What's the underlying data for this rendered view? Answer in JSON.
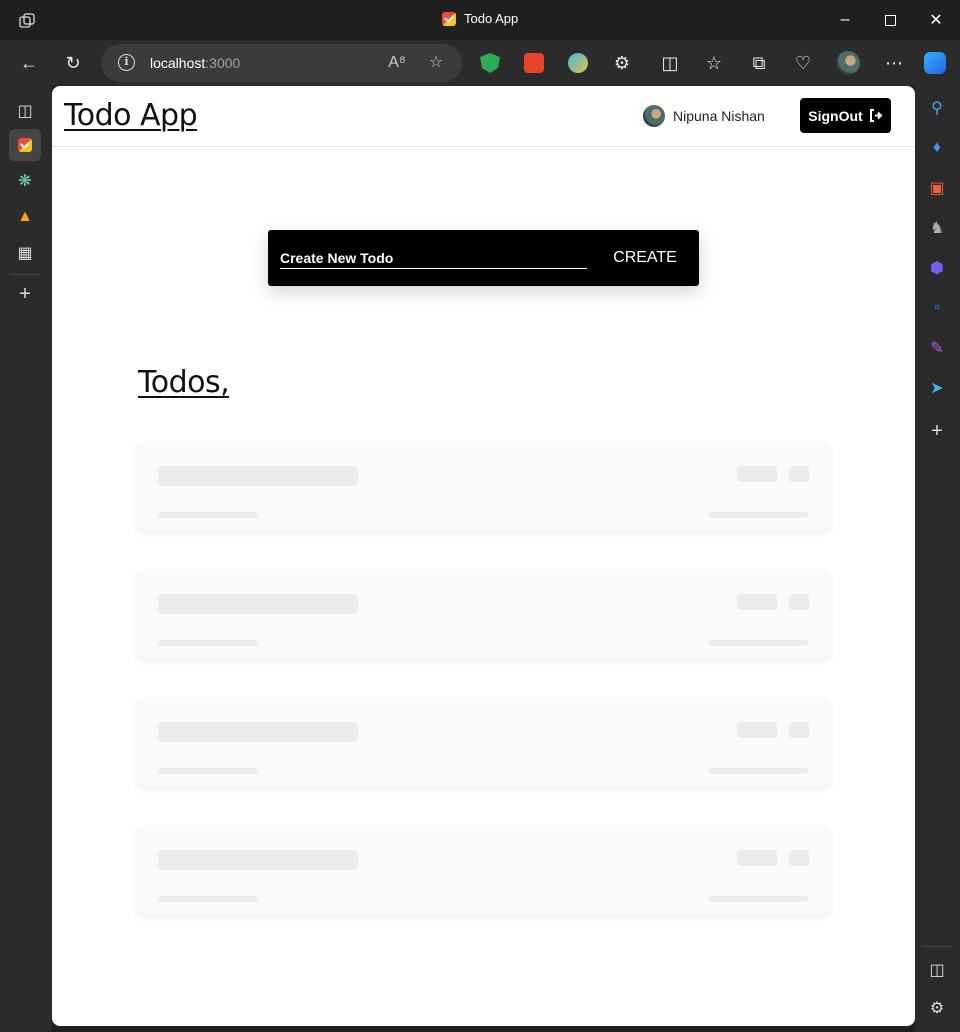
{
  "browser": {
    "tab_title": "Todo App",
    "url_host": "localhost",
    "url_port": ":3000"
  },
  "app": {
    "title": "Todo App",
    "user_name": "Nipuna Nishan",
    "signout_label": "SignOut",
    "create": {
      "placeholder": "Create New Todo",
      "button_label": "CREATE"
    },
    "todos_heading": "Todos,",
    "skeleton_cards": 4
  },
  "colors": {
    "primary": "#000000",
    "background": "#ffffff",
    "skeleton": "#ececec",
    "browser_chrome": "#202020"
  }
}
